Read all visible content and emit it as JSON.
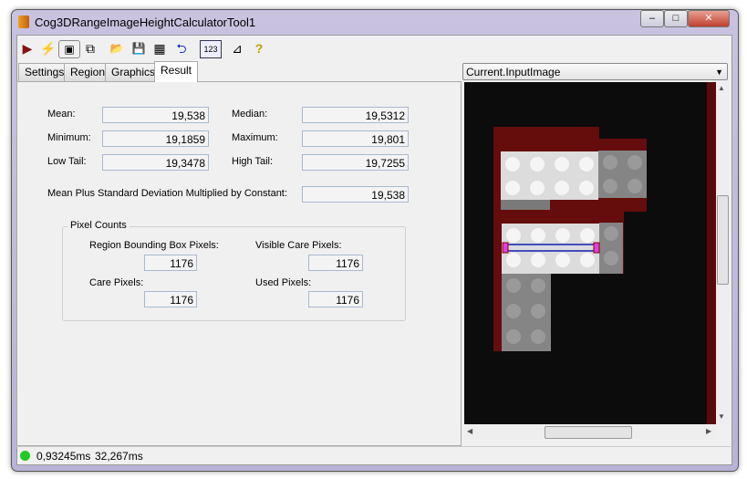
{
  "window": {
    "title": "Cog3DRangeImageHeightCalculatorTool1",
    "minimize": "–",
    "maximize": "□",
    "close": "✕"
  },
  "toolbar": [
    {
      "icon": "run-icon",
      "glyph": "▶"
    },
    {
      "icon": "lightning-icon",
      "glyph": "⚡"
    },
    {
      "icon": "show-controls-icon",
      "glyph": "▣"
    },
    {
      "icon": "floating-window-icon",
      "glyph": "⧉"
    },
    {
      "icon": "open-folder-icon",
      "glyph": "📂"
    },
    {
      "icon": "save-icon",
      "glyph": "💾"
    },
    {
      "icon": "save-as-icon",
      "glyph": "▦"
    },
    {
      "icon": "reset-icon",
      "glyph": "⮌"
    },
    {
      "icon": "numeric-display-icon",
      "glyph": "123"
    },
    {
      "icon": "pointer-ruler-icon",
      "glyph": "⊿"
    },
    {
      "icon": "help-icon",
      "glyph": "?"
    }
  ],
  "tabs": [
    "Settings",
    "Region",
    "Graphics",
    "Result"
  ],
  "active_tab": "Result",
  "results": {
    "mean": {
      "label": "Mean:",
      "value": "19,538"
    },
    "median": {
      "label": "Median:",
      "value": "19,5312"
    },
    "minimum": {
      "label": "Minimum:",
      "value": "19,1859"
    },
    "maximum": {
      "label": "Maximum:",
      "value": "19,801"
    },
    "low_tail": {
      "label": "Low Tail:",
      "value": "19,3478"
    },
    "high_tail": {
      "label": "High Tail:",
      "value": "19,7255"
    },
    "mean_plus": {
      "label": "Mean Plus Standard Deviation Multiplied by Constant:",
      "value": "19,538"
    }
  },
  "pixel_counts": {
    "title": "Pixel Counts",
    "region_bbox": {
      "label": "Region Bounding Box Pixels:",
      "value": "1176"
    },
    "visible_care": {
      "label": "Visible Care Pixels:",
      "value": "1176"
    },
    "care": {
      "label": "Care Pixels:",
      "value": "1176"
    },
    "used": {
      "label": "Used Pixels:",
      "value": "1176"
    }
  },
  "image_selector": {
    "value": "Current.InputImage"
  },
  "status": {
    "time1": "0,93245ms",
    "time2": "32,267ms",
    "color": "#22cc22"
  }
}
